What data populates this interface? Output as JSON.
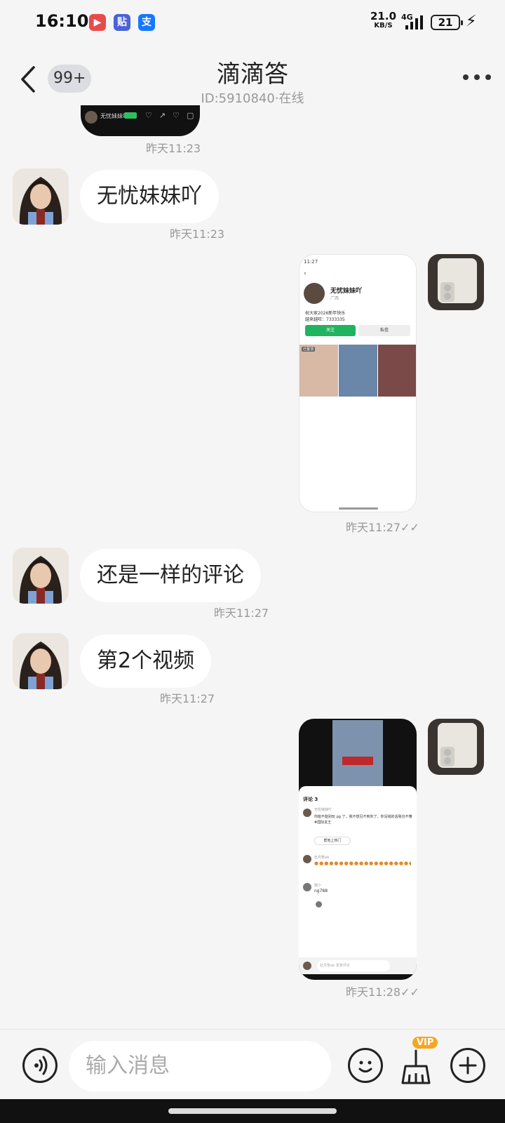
{
  "status_bar": {
    "time": "16:10",
    "apps": [
      "video-app-icon",
      "tieba-icon",
      "alipay-icon"
    ],
    "app_glyphs": {
      "tieba": "贴",
      "alipay": "支"
    },
    "net_speed": "21.0",
    "net_speed_unit": "KB/S",
    "network": "4G",
    "battery": "21"
  },
  "header": {
    "unread_badge": "99+",
    "title": "滴滴答",
    "subtitle": "ID:5910840·在线"
  },
  "messages": [
    {
      "type": "image",
      "side": "right",
      "time": "昨天11:23",
      "partial": true,
      "name": "无忧妹妹吖"
    },
    {
      "type": "text",
      "side": "left",
      "text": "无忧妹妹吖",
      "time": "昨天11:23"
    },
    {
      "type": "image",
      "side": "right",
      "time": "昨天11:27",
      "preview": {
        "name": "无忧妹妹吖",
        "region": "广西",
        "bio1": "祝大家2026新年快乐",
        "bio2": "越来越旺：7333335",
        "follow": "关注",
        "message": "私信",
        "tag": "已置顶"
      }
    },
    {
      "type": "text",
      "side": "left",
      "text": "还是一样的评论",
      "time": "昨天11:27"
    },
    {
      "type": "text",
      "side": "left",
      "text": "第2个视频",
      "time": "昨天11:27"
    },
    {
      "type": "image",
      "side": "right",
      "time": "昨天11:28",
      "preview": {
        "comments_title": "评论 3",
        "c1_name": "无忧妹妹吖",
        "c1_text": "你能不能别玩 pg 了，我不想见不到你了，你没钱的话我也不懂#国际友王",
        "help": "帮他上热门",
        "c2_name": "杜月笙ab",
        "c3_name": "熊少",
        "c3_text": "ng788",
        "input": "杜月笙ab 发表评论"
      }
    }
  ],
  "input_bar": {
    "placeholder": "输入消息",
    "vip_label": "VIP"
  }
}
